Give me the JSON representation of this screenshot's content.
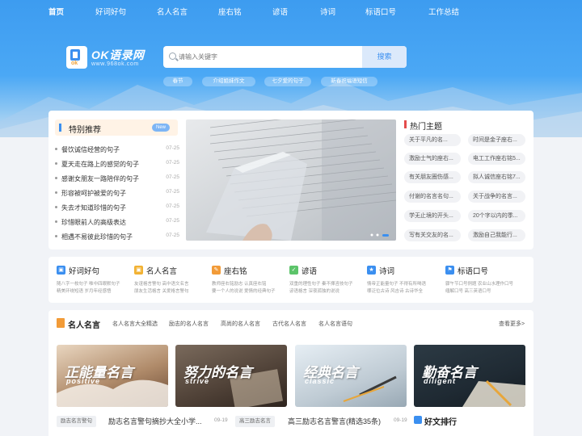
{
  "nav": [
    "首页",
    "好词好句",
    "名人名言",
    "座右铭",
    "谚语",
    "诗词",
    "标语口号",
    "工作总结"
  ],
  "logo": {
    "name": "OK语录网",
    "url": "www.968ok.com"
  },
  "search": {
    "placeholder": "请输入关键字",
    "button": "搜索"
  },
  "hot_tags": [
    "春节",
    "介绍姐妹作文",
    "七夕爱的句子",
    "新春祝福语短信"
  ],
  "featured": {
    "title": "特别推荐",
    "badge": "New",
    "items": [
      {
        "text": "餐饮诚信经营的句子",
        "date": "07-25"
      },
      {
        "text": "夏天走在路上的感觉的句子",
        "date": "07-25"
      },
      {
        "text": "感谢女朋友一路陪伴的句子",
        "date": "07-25"
      },
      {
        "text": "形容被呵护被爱的句子",
        "date": "07-25"
      },
      {
        "text": "失去才知道珍惜的句子",
        "date": "07-25"
      },
      {
        "text": "珍惜眼前人的高级表达",
        "date": "07-25"
      },
      {
        "text": "相遇不易彼此珍惜的句子",
        "date": "07-25"
      }
    ]
  },
  "hot_topics": {
    "title": "热门主题",
    "items": [
      "关于平凡的名...",
      "时间是金子座右...",
      "激励士气的座右...",
      "电工工作座右铭5...",
      "有关朋友圈伤感...",
      "拟人诚信座右铭7...",
      "付谢的名言名句...",
      "关于战争的名言...",
      "学无止境的开头...",
      "20个字以内的季...",
      "写有关交友的名...",
      "激励自己我能行..."
    ]
  },
  "categories": [
    {
      "name": "好词好句",
      "color": "#3b8ff0",
      "sub1": "随八字一枚句子   唯中四眼默句子",
      "sub2": "精美环绕短语   岁月年经感悟"
    },
    {
      "name": "名人名言",
      "color": "#f2b233",
      "sub1": "友谊格言警句   高中语文名言",
      "sub2": "朋友生活格言   关爱格言警句"
    },
    {
      "name": "座右铭",
      "color": "#f29b38",
      "sub1": "教师座右铭励志   认真座右铭",
      "sub2": "要一个人的说说   爱情的经典句子"
    },
    {
      "name": "谚语",
      "color": "#5cc46a",
      "sub1": "双重的理性句子   秦不揮咨技句子",
      "sub2": "谚语格言   深夜孤独的说说"
    },
    {
      "name": "诗词",
      "color": "#3b8ff0",
      "sub1": "情帝正能量句子   不得有所喝语",
      "sub2": "哪泛位古诗   风吉诗   古诗华全"
    },
    {
      "name": "标语口号",
      "color": "#3b8ff0",
      "sub1": "骤午节口号例题   农业山水理作口号",
      "sub2": "缅解口号   高三英语口号"
    }
  ],
  "famous": {
    "title": "名人名言",
    "links": [
      "名人名言大全精选",
      "励志的名人名言",
      "高尚的名人名言",
      "古代名人名言",
      "名人名言语句"
    ],
    "more": "查看更多>",
    "cards": [
      {
        "title": "正能量名言",
        "sub": "positive"
      },
      {
        "title": "努力的名言",
        "sub": "strive"
      },
      {
        "title": "经典名言",
        "sub": "classic"
      },
      {
        "title": "勤奋名言",
        "sub": "diligent"
      }
    ],
    "list": [
      {
        "tag": "励志名言警句",
        "text": "励志名言警句摘抄大全小学...",
        "date": "09-19"
      },
      {
        "tag": "高三励志名言",
        "text": "高三励志名言警言(精选35条)",
        "date": "09-19"
      }
    ]
  },
  "ranking": {
    "title": "好文排行"
  }
}
